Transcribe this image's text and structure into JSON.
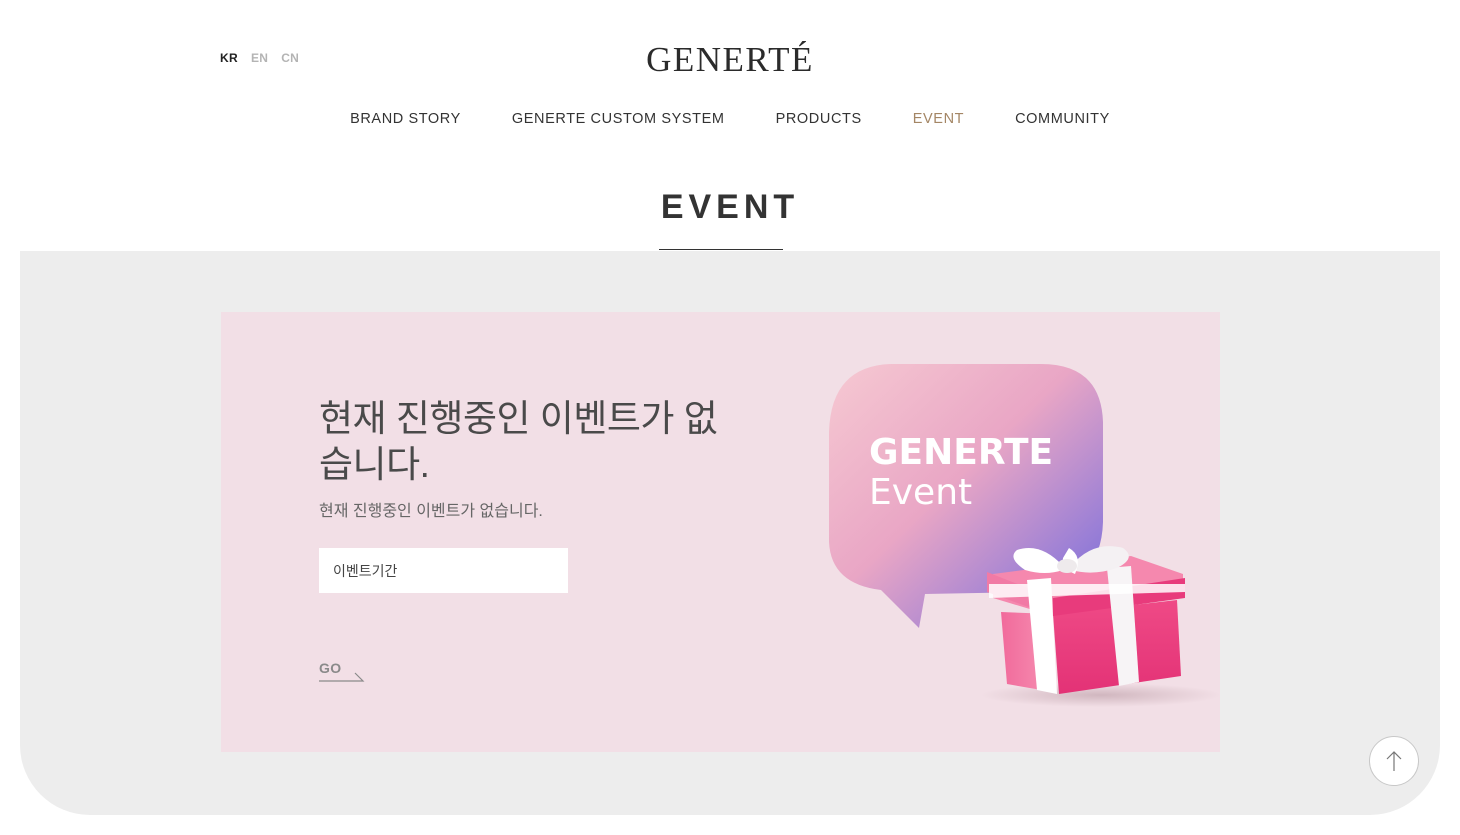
{
  "header": {
    "languages": [
      {
        "label": "KR",
        "active": true
      },
      {
        "label": "EN",
        "active": false
      },
      {
        "label": "CN",
        "active": false
      }
    ],
    "logo_text": "GENERTÉ"
  },
  "nav": {
    "items": [
      {
        "label": "BRAND STORY",
        "active": false
      },
      {
        "label": "GENERTE CUSTOM SYSTEM",
        "active": false
      },
      {
        "label": "PRODUCTS",
        "active": false
      },
      {
        "label": "EVENT",
        "active": true
      },
      {
        "label": "COMMUNITY",
        "active": false
      }
    ]
  },
  "section": {
    "title": "EVENT"
  },
  "event_card": {
    "heading": "현재 진행중인 이벤트가 없습니다.",
    "subtext": "현재 진행중인 이벤트가 없습니다.",
    "period_label": "이벤트기간",
    "go_label": "GO",
    "image_text_line1": "GENERTE",
    "image_text_line2": "Event"
  },
  "controls": {
    "scroll_top_icon": "arrow-up-icon"
  },
  "colors": {
    "accent": "#a48665",
    "panel_bg": "#ededed",
    "card_bg": "#f2dfe6",
    "gift_pink": "#ec3f80"
  }
}
